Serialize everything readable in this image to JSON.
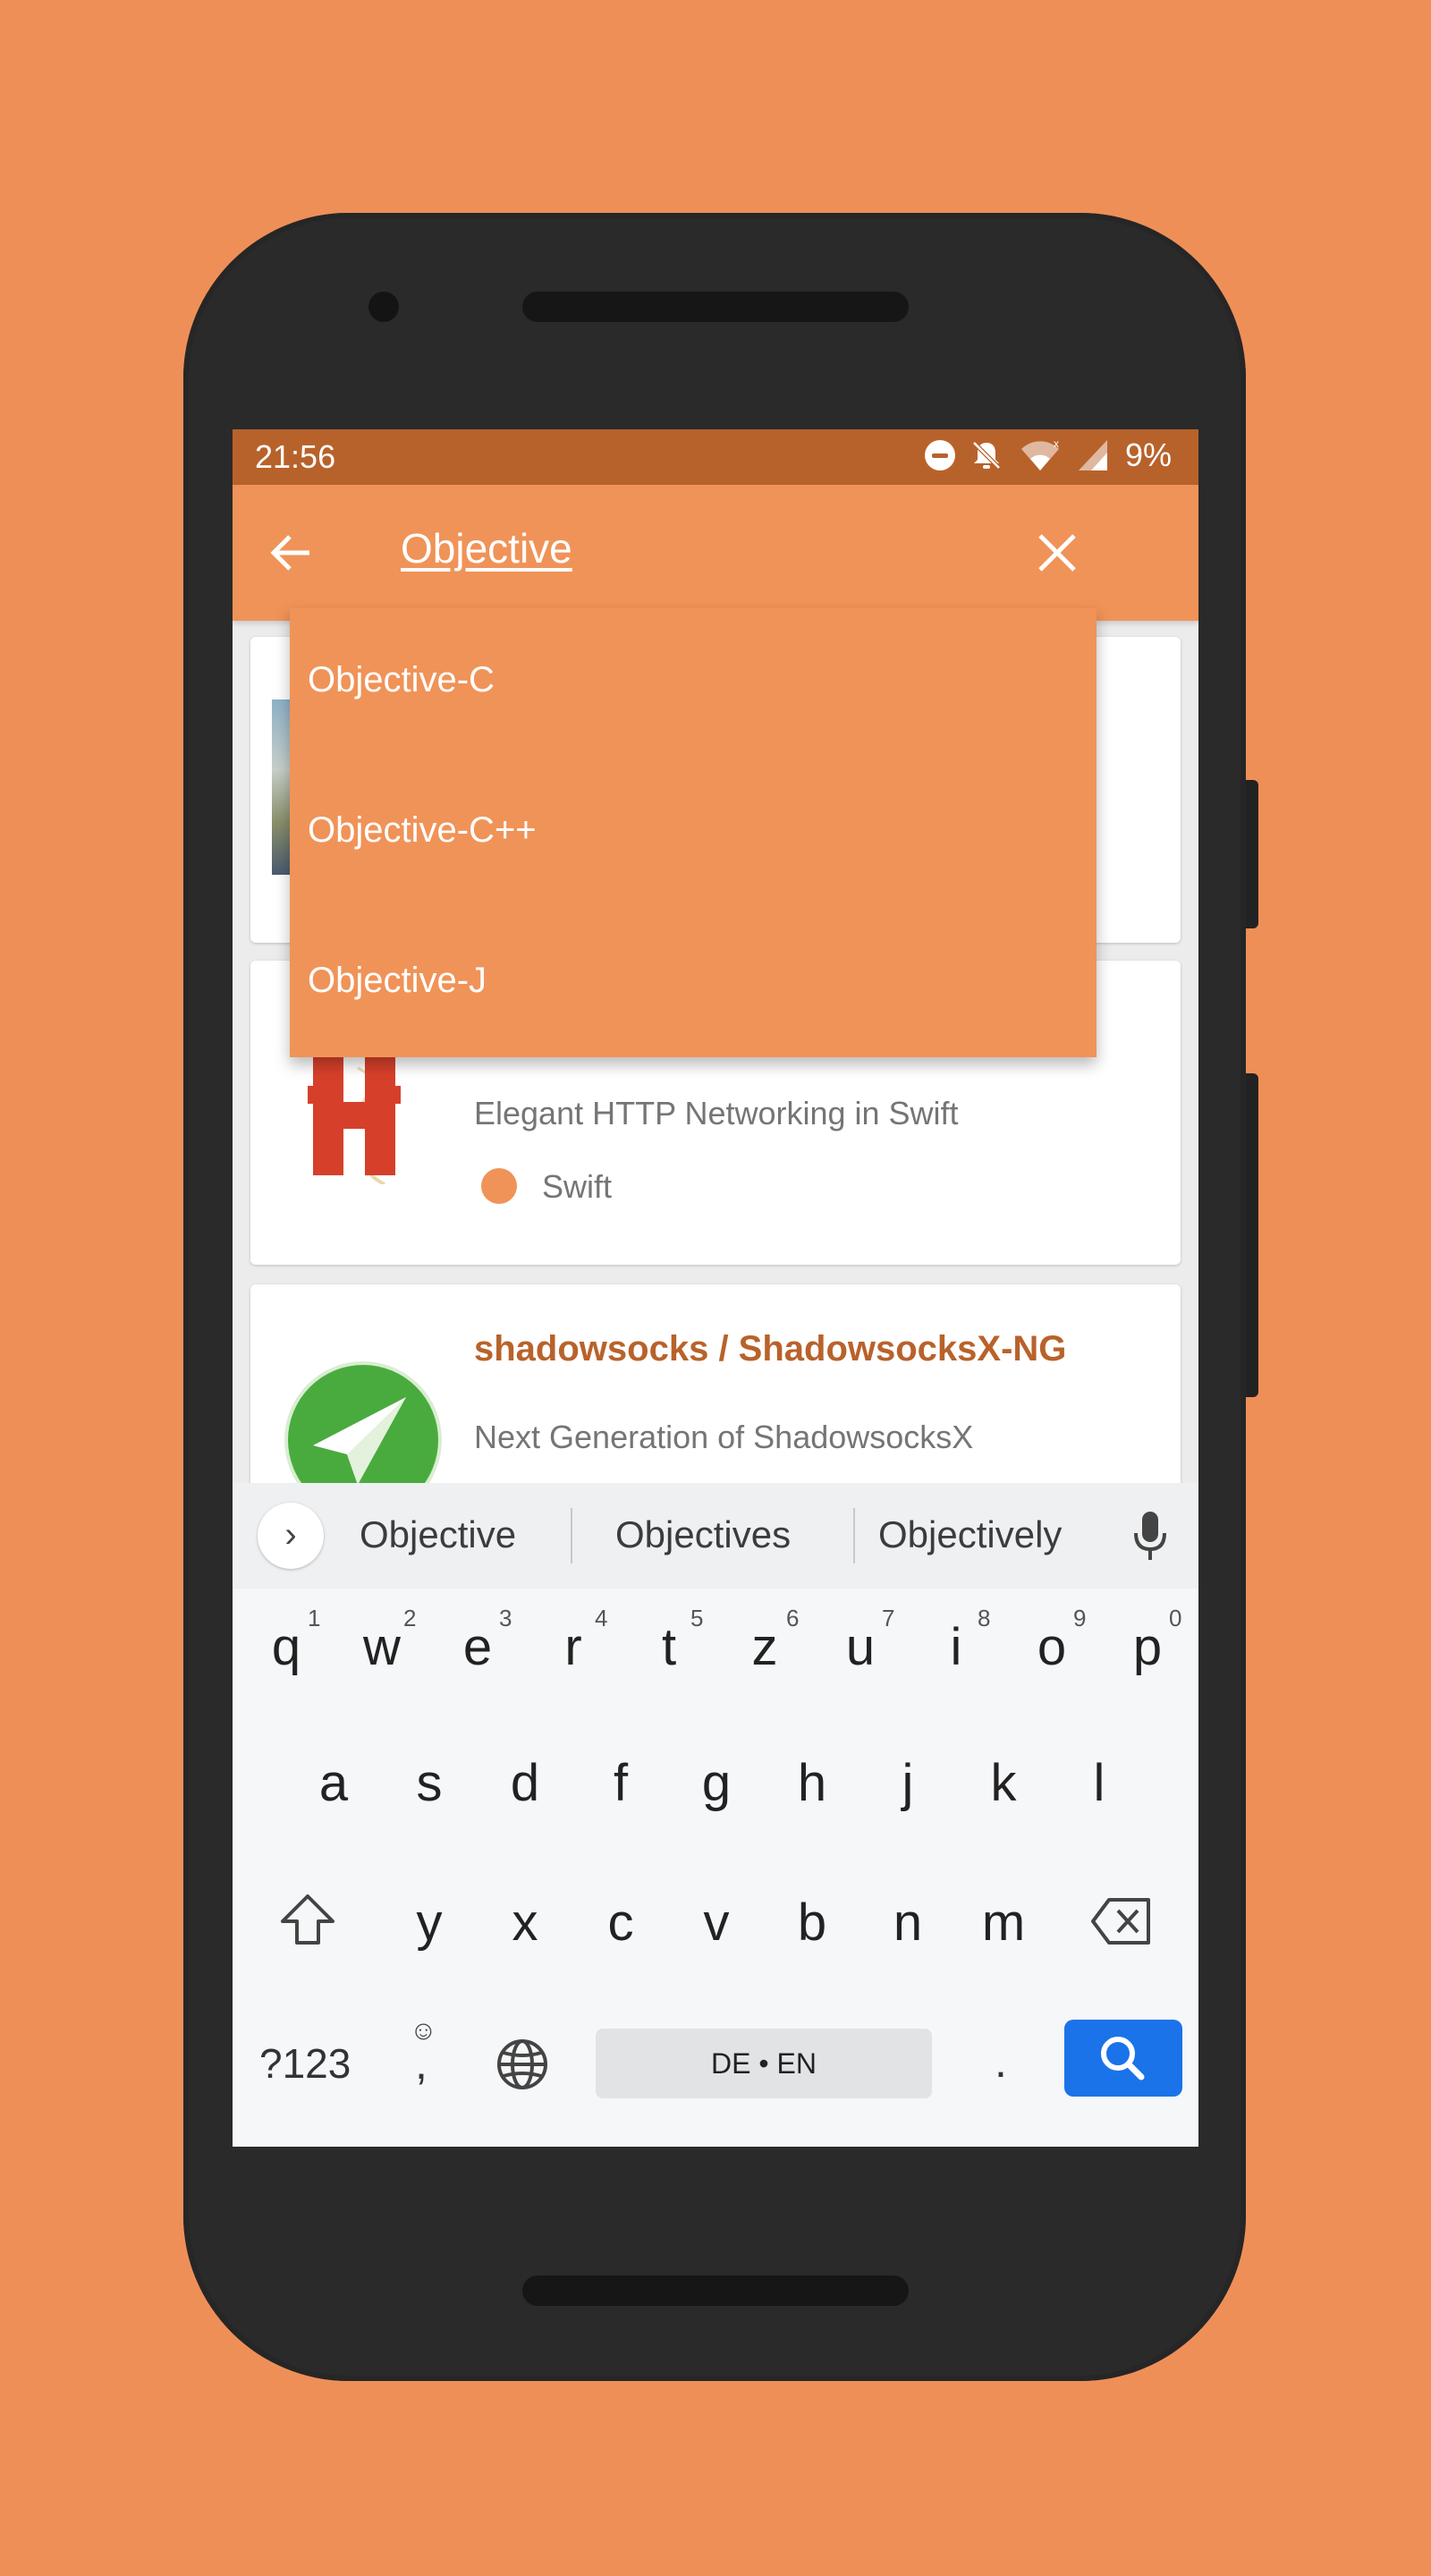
{
  "status_bar": {
    "time": "21:56",
    "battery": "9%"
  },
  "search": {
    "query": "Objective"
  },
  "autocomplete": {
    "options": [
      "Objective-C",
      "Objective-C++",
      "Objective-J"
    ]
  },
  "repos": [
    {
      "title": "",
      "description": "",
      "language": ""
    },
    {
      "title": "",
      "description": "Elegant HTTP Networking in Swift",
      "language": "Swift"
    },
    {
      "title": "shadowsocks / ShadowsocksX-NG",
      "description": "Next Generation of ShadowsocksX",
      "language": ""
    }
  ],
  "keyboard": {
    "suggestions": [
      "Objective",
      "Objectives",
      "Objectively"
    ],
    "row1": [
      "q",
      "w",
      "e",
      "r",
      "t",
      "z",
      "u",
      "i",
      "o",
      "p"
    ],
    "row1_hints": [
      "1",
      "2",
      "3",
      "4",
      "5",
      "6",
      "7",
      "8",
      "9",
      "0"
    ],
    "row2": [
      "a",
      "s",
      "d",
      "f",
      "g",
      "h",
      "j",
      "k",
      "l"
    ],
    "row3": [
      "y",
      "x",
      "c",
      "v",
      "b",
      "n",
      "m"
    ],
    "symbols_label": "?123",
    "comma": ",",
    "emoji_hint": "☺",
    "space_label": "DE • EN",
    "period": "."
  },
  "colors": {
    "background": "#EF8F58",
    "status_bar": "#B8622B",
    "app_bar": "#F09358",
    "accent_text": "#B8622B",
    "search_key": "#1A73E8"
  }
}
